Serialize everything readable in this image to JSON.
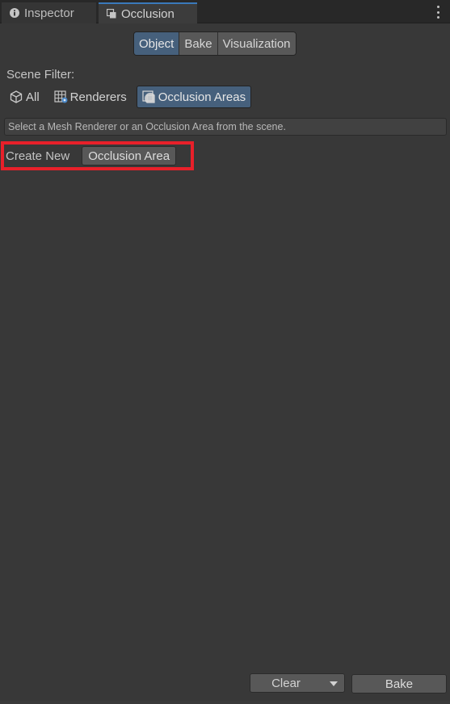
{
  "tabs": [
    {
      "label": "Inspector",
      "icon": "info-icon",
      "active": false
    },
    {
      "label": "Occlusion",
      "icon": "occlusion-icon",
      "active": true
    }
  ],
  "modes": {
    "items": [
      "Object",
      "Bake",
      "Visualization"
    ],
    "selected": "Object"
  },
  "scene_filter": {
    "label": "Scene Filter:",
    "options": [
      {
        "label": "All",
        "icon": "cube-icon"
      },
      {
        "label": "Renderers",
        "icon": "renderer-icon"
      },
      {
        "label": "Occlusion Areas",
        "icon": "occlusion-area-icon"
      }
    ],
    "selected": "Occlusion Areas"
  },
  "help_text": "Select a Mesh Renderer or an Occlusion Area from the scene.",
  "create_new": {
    "label": "Create New",
    "button": "Occlusion Area"
  },
  "footer": {
    "clear_label": "Clear",
    "bake_label": "Bake"
  },
  "colors": {
    "highlight": "#e8202a",
    "selected": "#46607c",
    "panel_bg": "#383838"
  }
}
